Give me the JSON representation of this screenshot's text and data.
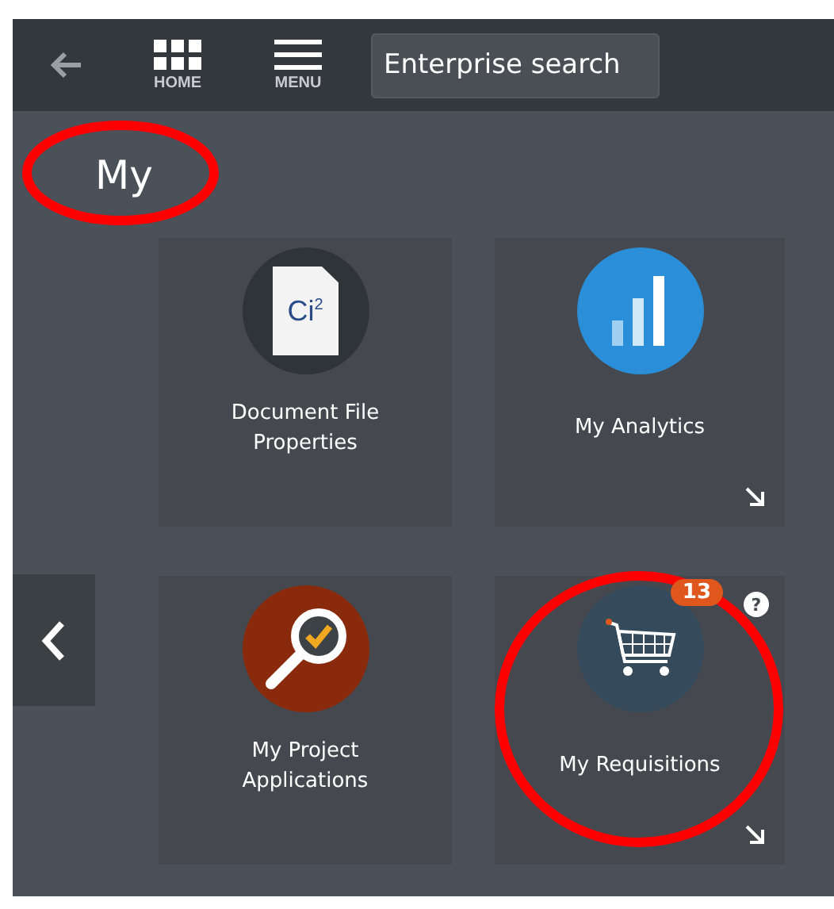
{
  "top_bar": {
    "home_label": "HOME",
    "menu_label": "MENU",
    "search": {
      "placeholder": "Enterprise search"
    }
  },
  "page_title": {
    "text": "My",
    "circled": true
  },
  "tiles": [
    {
      "kind": "document",
      "icon_text": "Ci",
      "icon_sup": "2",
      "label": "Document File Properties",
      "expandable": false,
      "circled": false
    },
    {
      "kind": "analytics",
      "label": "My Analytics",
      "expandable": true,
      "circled": false
    },
    {
      "kind": "project",
      "label": "My Project Applications",
      "expandable": false,
      "circled": false
    },
    {
      "kind": "cart",
      "label": "My Requisitions",
      "badge": "13",
      "help": "?",
      "expandable": true,
      "circled": true
    }
  ]
}
